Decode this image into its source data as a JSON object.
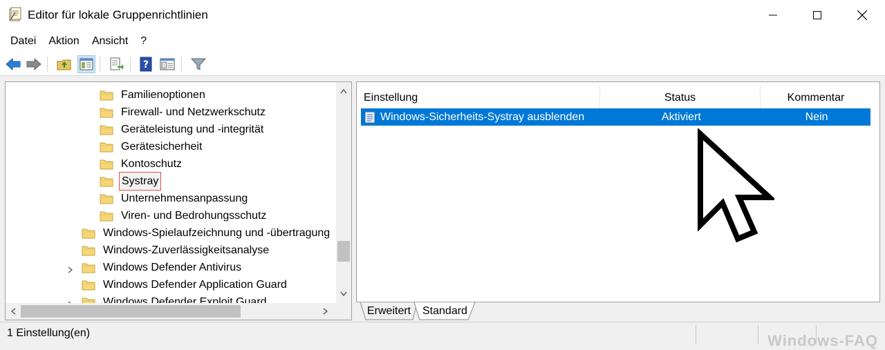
{
  "window": {
    "title": "Editor für lokale Gruppenrichtlinien",
    "icon": "policy-editor-icon",
    "minimize_glyph": "—",
    "maximize_glyph": "☐",
    "close_glyph": "✕"
  },
  "menu": [
    "Datei",
    "Aktion",
    "Ansicht",
    "?"
  ],
  "toolbar": {
    "icons": [
      "back-arrow-icon",
      "forward-arrow-icon",
      "up-folder-icon",
      "show-hide-tree-icon",
      "export-list-icon",
      "help-icon",
      "properties-icon",
      "filter-icon"
    ]
  },
  "tree": {
    "items": [
      {
        "label": "Familienoptionen",
        "level": 2,
        "expandable": false,
        "selected": false
      },
      {
        "label": "Firewall- und Netzwerkschutz",
        "level": 2,
        "expandable": false,
        "selected": false
      },
      {
        "label": "Geräteleistung und -integrität",
        "level": 2,
        "expandable": false,
        "selected": false
      },
      {
        "label": "Gerätesicherheit",
        "level": 2,
        "expandable": false,
        "selected": false
      },
      {
        "label": "Kontoschutz",
        "level": 2,
        "expandable": false,
        "selected": false
      },
      {
        "label": "Systray",
        "level": 2,
        "expandable": false,
        "selected": true
      },
      {
        "label": "Unternehmensanpassung",
        "level": 2,
        "expandable": false,
        "selected": false
      },
      {
        "label": "Viren- und Bedrohungsschutz",
        "level": 2,
        "expandable": false,
        "selected": false
      },
      {
        "label": "Windows-Spielaufzeichnung und -übertragung",
        "level": 1,
        "expandable": false,
        "selected": false
      },
      {
        "label": "Windows-Zuverlässigkeitsanalyse",
        "level": 1,
        "expandable": false,
        "selected": false
      },
      {
        "label": "Windows Defender Antivirus",
        "level": 1,
        "expandable": true,
        "selected": false
      },
      {
        "label": "Windows Defender Application Guard",
        "level": 1,
        "expandable": false,
        "selected": false
      },
      {
        "label": "Windows Defender Exploit Guard",
        "level": 1,
        "expandable": true,
        "selected": false
      }
    ]
  },
  "list": {
    "columns": [
      "Einstellung",
      "Status",
      "Kommentar"
    ],
    "rows": [
      {
        "icon": "policy-setting-icon",
        "setting": "Windows-Sicherheits-Systray ausblenden",
        "status": "Aktiviert",
        "comment": "Nein"
      }
    ]
  },
  "tabs": [
    {
      "label": "Erweitert",
      "active": false
    },
    {
      "label": "Standard",
      "active": true
    }
  ],
  "status": {
    "text": "1 Einstellung(en)",
    "watermark": "Windows-FAQ"
  },
  "colors": {
    "selection": "#0078d7",
    "highlight_border": "#e05050"
  }
}
